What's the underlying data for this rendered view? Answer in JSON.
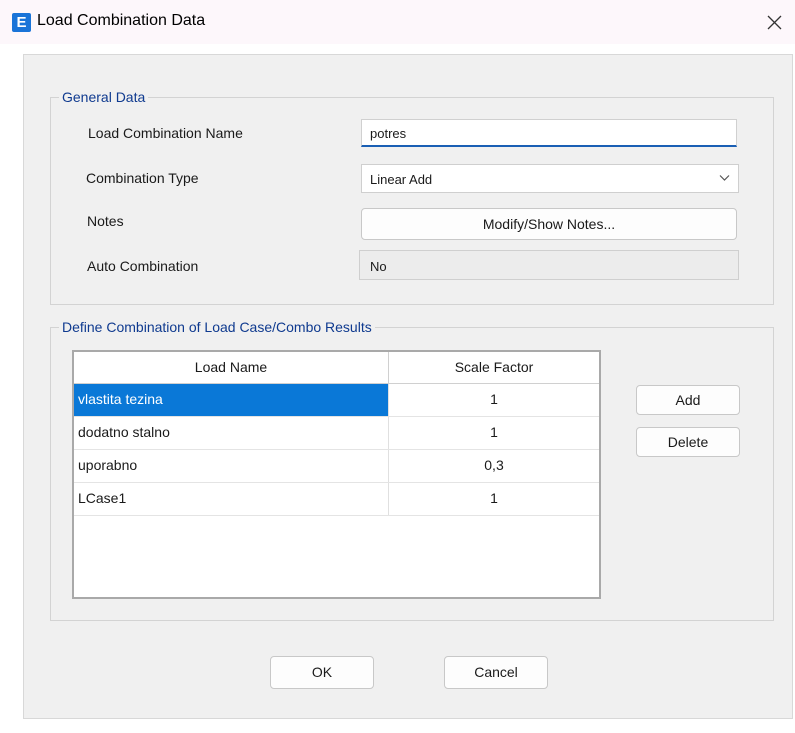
{
  "window": {
    "title": "Load Combination Data",
    "app_icon_letter": "E",
    "accent_color": "#1a74d8"
  },
  "general": {
    "legend": "General Data",
    "name_label": "Load Combination Name",
    "name_value": "potres",
    "type_label": "Combination Type",
    "type_value": "Linear Add",
    "notes_label": "Notes",
    "notes_button": "Modify/Show Notes...",
    "auto_label": "Auto Combination",
    "auto_value": "No"
  },
  "define": {
    "legend": "Define Combination of Load Case/Combo Results",
    "columns": [
      "Load Name",
      "Scale Factor"
    ],
    "rows": [
      {
        "name": "vlastita tezina",
        "factor": "1",
        "selected": true
      },
      {
        "name": "dodatno stalno",
        "factor": "1",
        "selected": false
      },
      {
        "name": "uporabno",
        "factor": "0,3",
        "selected": false
      },
      {
        "name": "LCase1",
        "factor": "1",
        "selected": false
      }
    ],
    "add_button": "Add",
    "delete_button": "Delete",
    "selection_color": "#0a78d7"
  },
  "footer": {
    "ok_button": "OK",
    "cancel_button": "Cancel"
  }
}
